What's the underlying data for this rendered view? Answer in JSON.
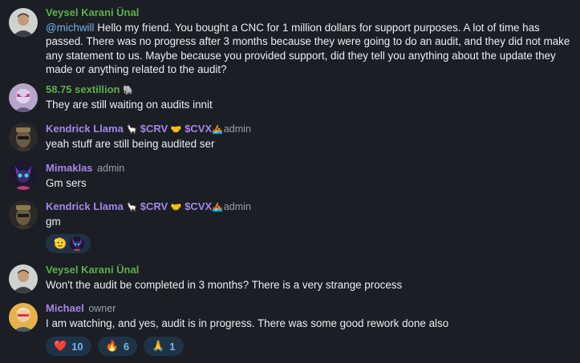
{
  "colors": {
    "background": "#1b1e24",
    "name_green": "#5bb14a",
    "name_purple": "#a487e9",
    "mention": "#6fb3ea",
    "reaction_bg": "#1f3347",
    "reaction_text": "#75b5ee"
  },
  "messages": [
    {
      "name": "Veysel Karani Ünal",
      "mention": "@michwill",
      "text": "Hello my friend. You bought a CNC for 1 million dollars for support purposes. A lot of time has passed. There was no progress after 3 months because they were going to do an audit, and they did not make any statement to us. Maybe because you provided support, did they tell you anything about the update they made or anything related to the audit?"
    },
    {
      "name": "58.75 sextillion",
      "name_emoji": "🐘",
      "text": "They are still waiting on audits innit"
    },
    {
      "name": "Kendrick Llama",
      "name_emoji_1": "🦙",
      "tag_1": "$CRV",
      "name_emoji_2": "🤝",
      "tag_2": "$CVX",
      "name_emoji_3": "🚣",
      "role": "admin",
      "text": "yeah stuff are still being audited ser"
    },
    {
      "name": "Mimaklas",
      "role": "admin",
      "text": "Gm sers"
    },
    {
      "name": "Kendrick Llama",
      "name_emoji_1": "🦙",
      "tag_1": "$CRV",
      "name_emoji_2": "🤝",
      "tag_2": "$CVX",
      "name_emoji_3": "🚣",
      "role": "admin",
      "text": "gm",
      "reaction_emoji": "🫡"
    },
    {
      "name": "Veysel Karani Ünal",
      "text": "Won't the audit be completed in 3 months? There is a very strange process"
    },
    {
      "name": "Michael",
      "role": "owner",
      "text": "I am watching, and yes, audit is in progress. There was some good rework done also",
      "reactions": [
        {
          "emoji": "❤️",
          "count": "10"
        },
        {
          "emoji": "🔥",
          "count": "6"
        },
        {
          "emoji": "🙏",
          "count": "1"
        }
      ]
    }
  ]
}
